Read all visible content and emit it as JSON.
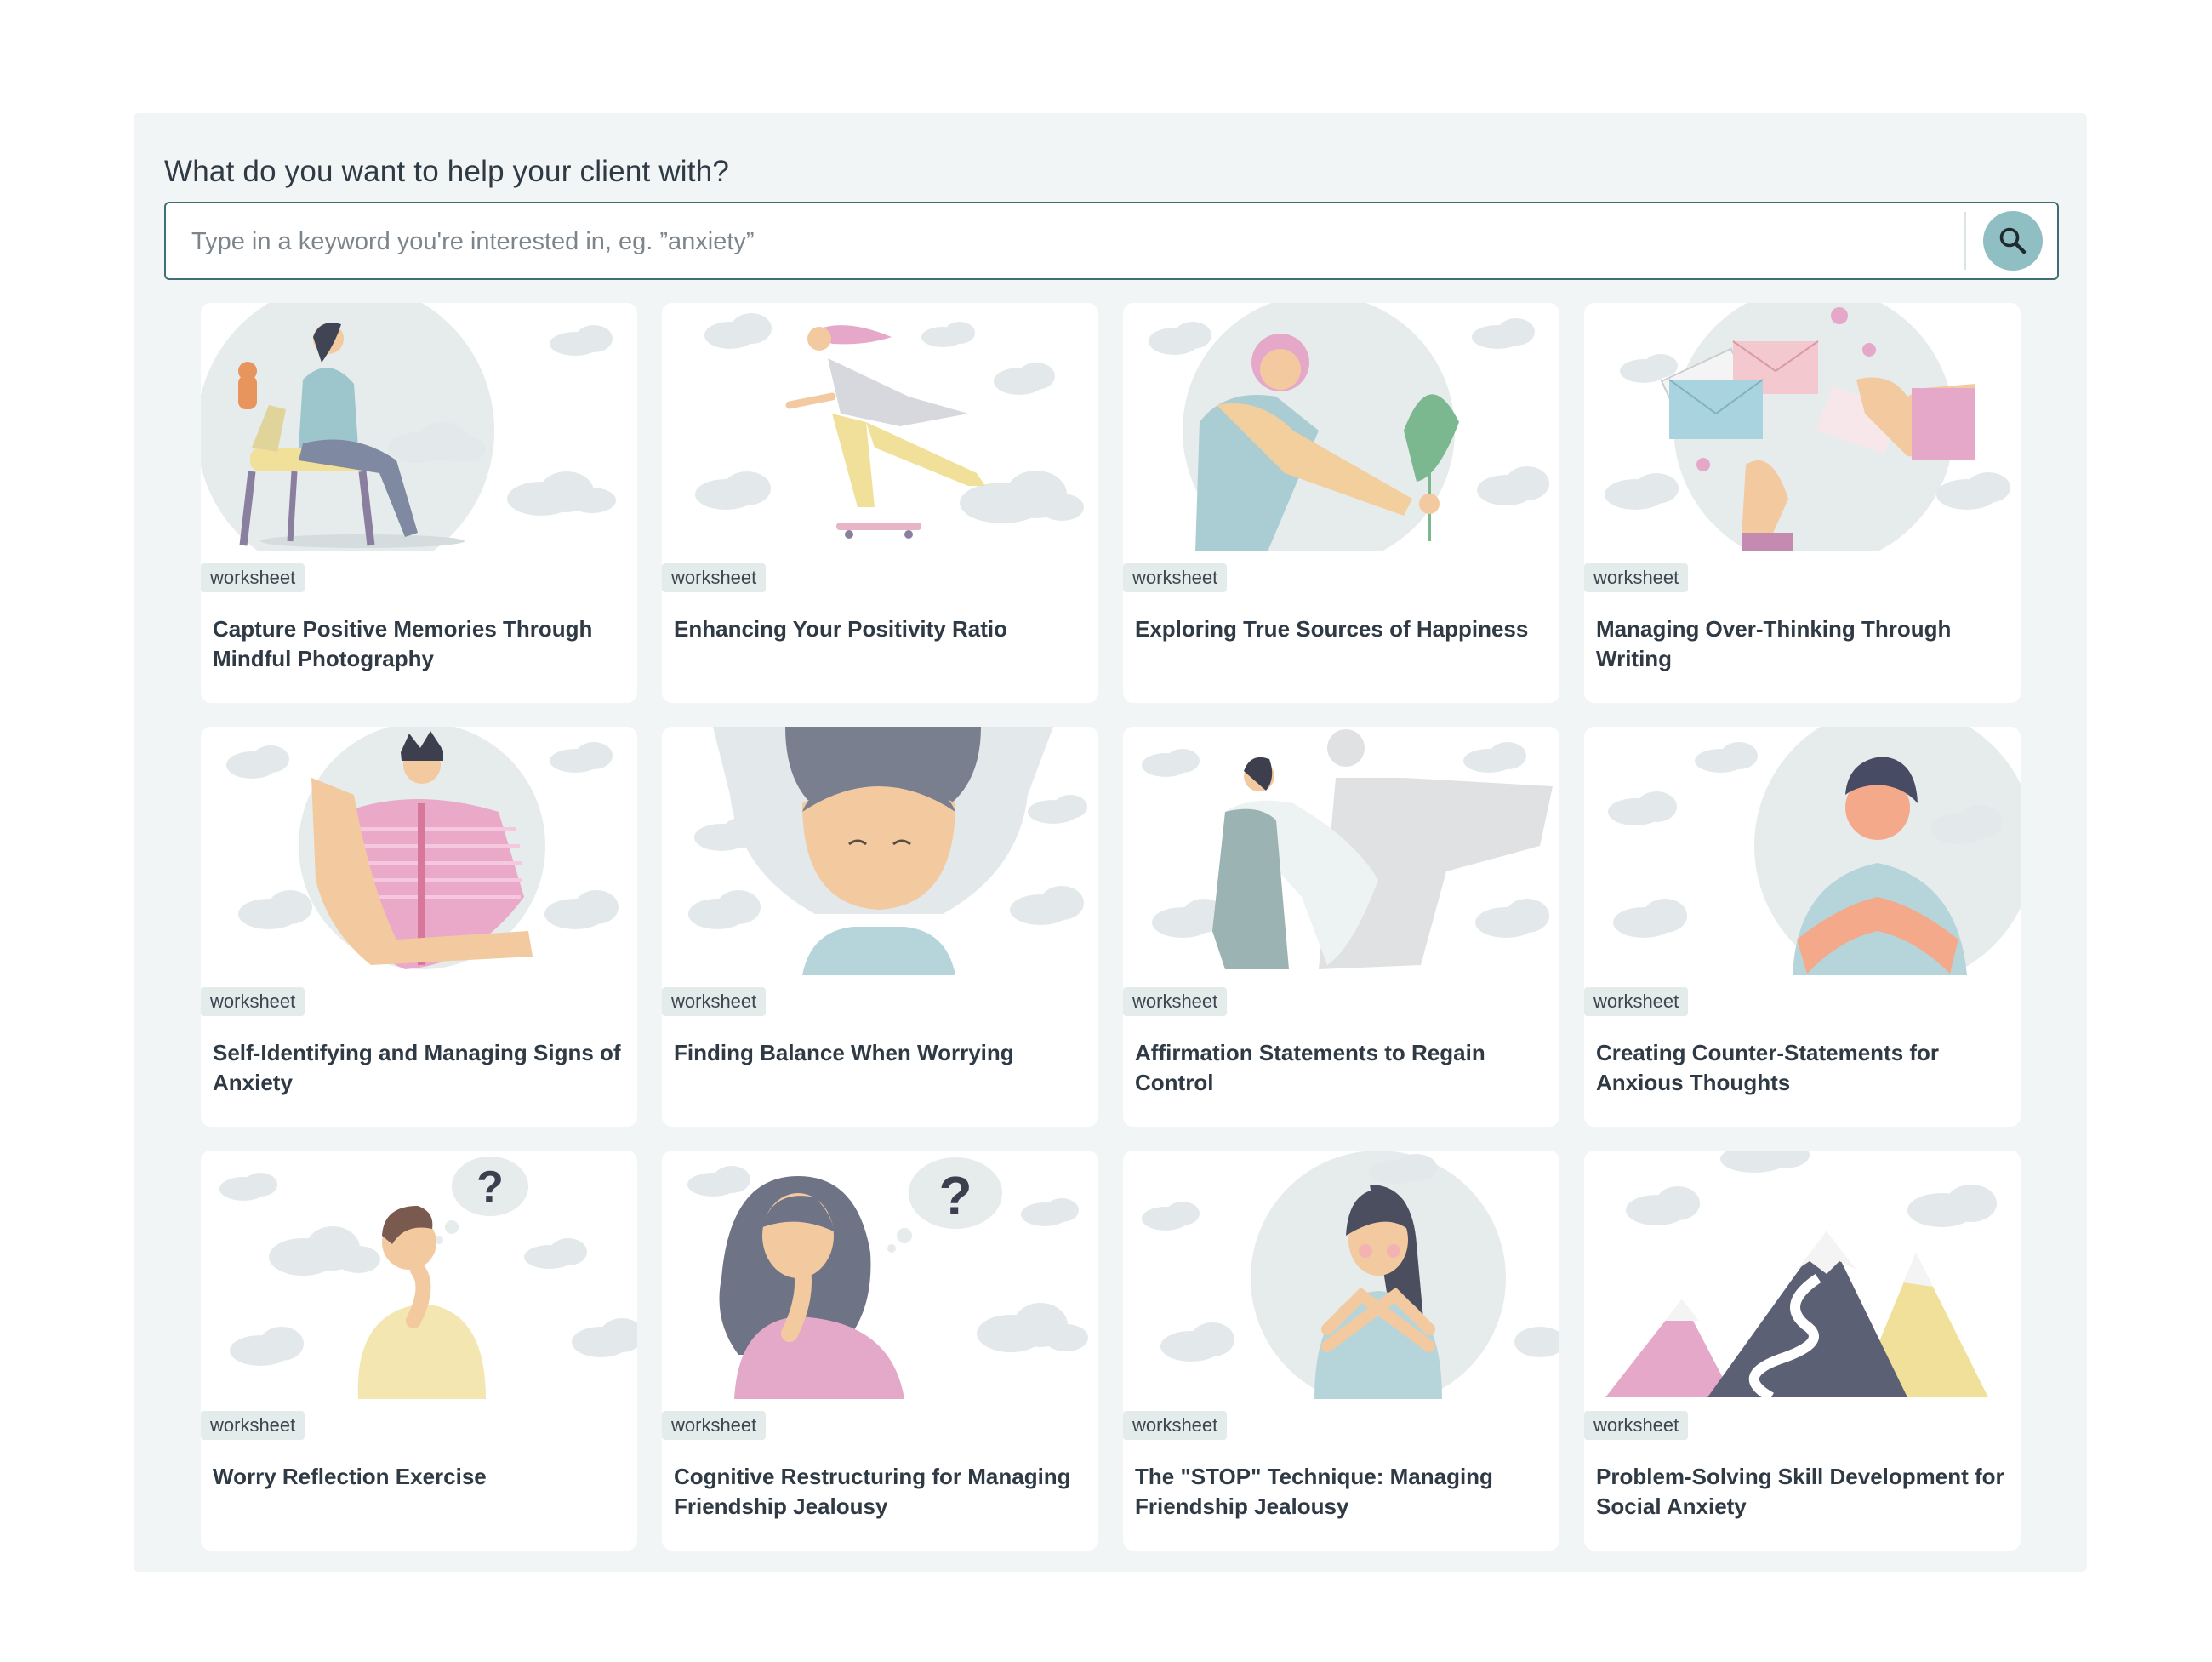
{
  "search": {
    "heading": "What do you want to help your client with?",
    "placeholder": "Type in a keyword you're interested in, eg. ”anxiety”",
    "value": "",
    "button_icon": "search-icon"
  },
  "colors": {
    "panel_bg": "#f1f5f5",
    "accent": "#3f6e73",
    "search_button": "#8fbfc3",
    "tag_bg": "#e3ebeb",
    "card_bg": "#ffffff"
  },
  "cards": [
    {
      "tag": "worksheet",
      "title": "Capture Positive Memories Through Mindful Photography",
      "illustration": "woman-sitting-with-phone-and-cat"
    },
    {
      "tag": "worksheet",
      "title": "Enhancing Your Positivity Ratio",
      "illustration": "woman-skateboarding"
    },
    {
      "tag": "worksheet",
      "title": "Exploring True Sources of Happiness",
      "illustration": "woman-holding-plant"
    },
    {
      "tag": "worksheet",
      "title": "Managing Over-Thinking Through Writing",
      "illustration": "hands-with-envelopes"
    },
    {
      "tag": "worksheet",
      "title": "Self-Identifying and Managing Signs of Anxiety",
      "illustration": "man-waving"
    },
    {
      "tag": "worksheet",
      "title": "Finding Balance When Worrying",
      "illustration": "woman-flowing-hair"
    },
    {
      "tag": "worksheet",
      "title": "Affirmation Statements to Regain Control",
      "illustration": "woman-with-hero-shadow"
    },
    {
      "tag": "worksheet",
      "title": "Creating Counter-Statements for Anxious Thoughts",
      "illustration": "man-calm-hands-together"
    },
    {
      "tag": "worksheet",
      "title": "Worry Reflection Exercise",
      "illustration": "man-thinking-question"
    },
    {
      "tag": "worksheet",
      "title": "Cognitive Restructuring for Managing Friendship Jealousy",
      "illustration": "woman-thinking-question"
    },
    {
      "tag": "worksheet",
      "title": "The \"STOP\" Technique: Managing Friendship Jealousy",
      "illustration": "woman-hugging-self"
    },
    {
      "tag": "worksheet",
      "title": "Problem-Solving Skill Development for Social Anxiety",
      "illustration": "mountains-with-path"
    }
  ]
}
